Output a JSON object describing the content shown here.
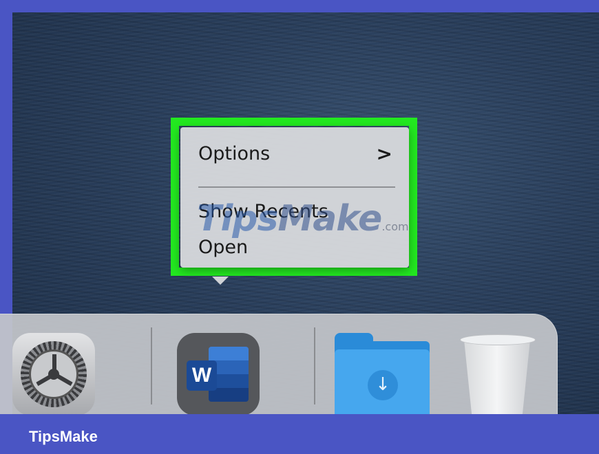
{
  "context_menu": {
    "items": [
      {
        "label": "Options",
        "submenu_indicator": ">"
      },
      {
        "label": "Show Recents"
      },
      {
        "label": "Open"
      }
    ],
    "highlight_color": "#23e820"
  },
  "watermark": {
    "text_a": "Tips",
    "text_b": "Make",
    "suffix": ".com"
  },
  "dock": {
    "apps": [
      {
        "name": "System Settings",
        "icon": "gear-icon"
      },
      {
        "name": "Microsoft Word",
        "icon": "word-icon",
        "badge_letter": "W"
      },
      {
        "name": "Downloads",
        "icon": "downloads-folder-icon"
      },
      {
        "name": "Trash",
        "icon": "trash-icon"
      }
    ]
  },
  "brand": {
    "label": "TipsMake",
    "bar_color": "#4a55c4"
  }
}
